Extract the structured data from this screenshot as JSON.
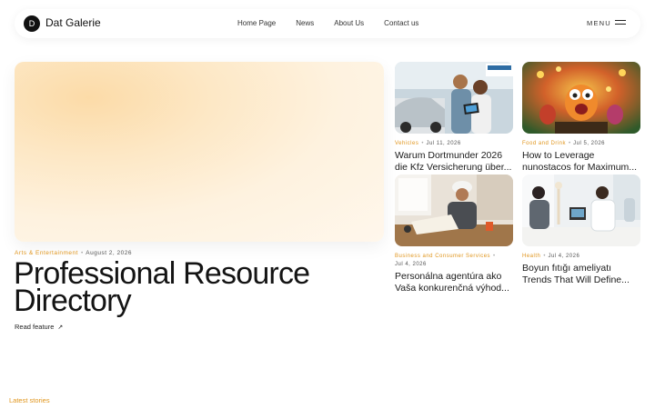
{
  "brand": {
    "logo_letter": "D",
    "name": "Dat Galerie"
  },
  "nav": [
    "Home Page",
    "News",
    "About Us",
    "Contact us"
  ],
  "menu_label": "MENU",
  "hero": {
    "category": "Arts & Entertainment",
    "date": "August 2, 2026",
    "title_line1": "Professional Resource",
    "title_line2": "Directory",
    "read_label": "Read feature",
    "arrow": "↗"
  },
  "cards": [
    {
      "category": "Vehicles",
      "date": "Jul 11, 2026",
      "line1": "Warum Dortmunder 2026",
      "line2": "die Kfz Versicherung über..."
    },
    {
      "category": "Food and Drink",
      "date": "Jul 5, 2026",
      "line1": "How to Leverage",
      "line2": "nunostacos for Maximum..."
    },
    {
      "category": "Business and Consumer Services",
      "date": "Jul 4, 2026",
      "line1": "Personálna agentúra ako",
      "line2": "Vaša konkurenčná výhod..."
    },
    {
      "category": "Health",
      "date": "Jul 4, 2026",
      "line1": "Boyun fıtığı ameliyatı",
      "line2": "Trends That Will Define..."
    }
  ],
  "latest_label": "Latest stories",
  "colors": {
    "accent": "#e0951c",
    "text": "#1c1c1c"
  }
}
